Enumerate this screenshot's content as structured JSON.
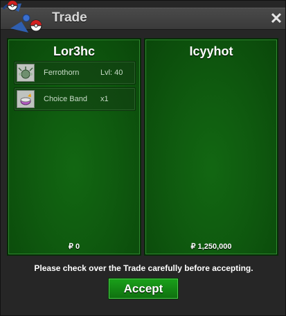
{
  "window": {
    "title": "Trade",
    "close_label": "✕"
  },
  "left_panel": {
    "name": "Lor3hc",
    "items": [
      {
        "name": "Ferrothorn",
        "detail": "Lvl: 40",
        "icon": "ferrothorn-icon"
      },
      {
        "name": "Choice Band",
        "detail": "x1",
        "icon": "choice-band-icon"
      }
    ],
    "money": "₽ 0"
  },
  "right_panel": {
    "name": "Icyyhot",
    "items": [],
    "money": "₽ 1,250,000"
  },
  "notice": "Please check over the Trade carefully before accepting.",
  "accept_label": "Accept",
  "colors": {
    "panel_green": "#0f5a0f",
    "button_green": "#1aa11a",
    "titlebar": "#3f3f3f"
  }
}
